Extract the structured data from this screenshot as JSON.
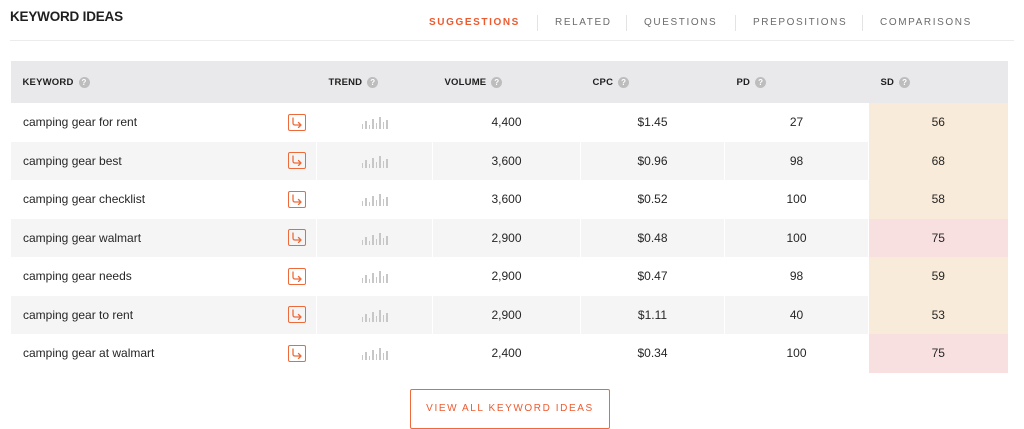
{
  "title": "KEYWORD IDEAS",
  "tabs": [
    {
      "label": "SUGGESTIONS",
      "active": true
    },
    {
      "label": "RELATED",
      "active": false
    },
    {
      "label": "QUESTIONS",
      "active": false
    },
    {
      "label": "PREPOSITIONS",
      "active": false
    },
    {
      "label": "COMPARISONS",
      "active": false
    }
  ],
  "table": {
    "headers": {
      "keyword": "KEYWORD",
      "trend": "TREND",
      "volume": "VOLUME",
      "cpc": "CPC",
      "pd": "PD",
      "sd": "SD"
    },
    "rows": [
      {
        "keyword": "camping gear for rent",
        "volume": "4,400",
        "cpc": "$1.45",
        "pd": "27",
        "sd": "56"
      },
      {
        "keyword": "camping gear best",
        "volume": "3,600",
        "cpc": "$0.96",
        "pd": "98",
        "sd": "68"
      },
      {
        "keyword": "camping gear checklist",
        "volume": "3,600",
        "cpc": "$0.52",
        "pd": "100",
        "sd": "58"
      },
      {
        "keyword": "camping gear walmart",
        "volume": "2,900",
        "cpc": "$0.48",
        "pd": "100",
        "sd": "75"
      },
      {
        "keyword": "camping gear needs",
        "volume": "2,900",
        "cpc": "$0.47",
        "pd": "98",
        "sd": "59"
      },
      {
        "keyword": "camping gear to rent",
        "volume": "2,900",
        "cpc": "$1.11",
        "pd": "40",
        "sd": "53"
      },
      {
        "keyword": "camping gear at walmart",
        "volume": "2,400",
        "cpc": "$0.34",
        "pd": "100",
        "sd": "75"
      }
    ]
  },
  "view_all_label": "VIEW ALL KEYWORD IDEAS",
  "colors": {
    "accent": "#ee5a2f",
    "sd_medium": "#f9ebd9",
    "sd_high": "#f8e0e0"
  },
  "icons": {
    "help": "question-circle-icon",
    "goto": "external-arrow-icon",
    "trend": "mini-bar-chart-icon"
  }
}
